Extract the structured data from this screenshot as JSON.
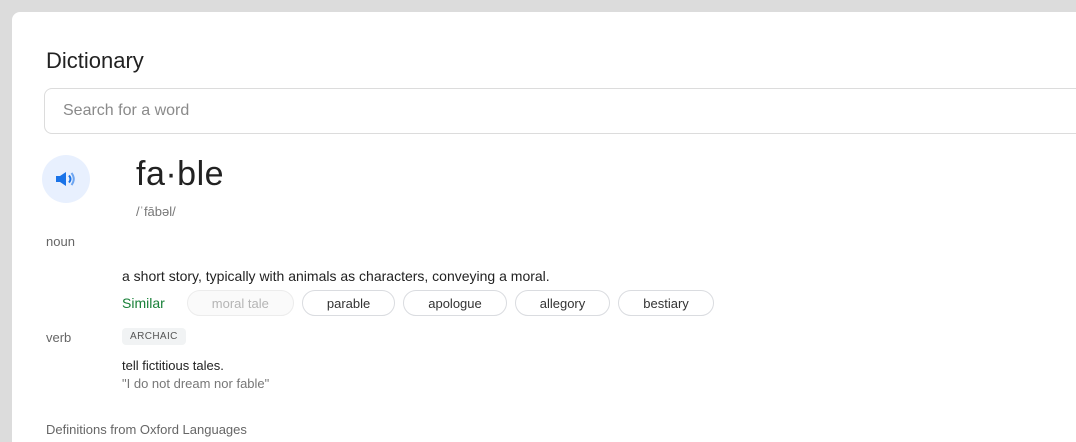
{
  "header": {
    "title": "Dictionary"
  },
  "search": {
    "placeholder": "Search for a word",
    "value": ""
  },
  "entry": {
    "word": "fa·ble",
    "phonetic": "/ˈfābəl/",
    "senses": [
      {
        "pos": "noun",
        "definition": "a short story, typically with animals as characters, conveying a moral.",
        "similar_label": "Similar",
        "similar": [
          "moral tale",
          "parable",
          "apologue",
          "allegory",
          "bestiary"
        ]
      },
      {
        "pos": "verb",
        "tag": "ARCHAIC",
        "definition": "tell fictitious tales.",
        "example": "\"I do not dream nor fable\""
      }
    ]
  },
  "footer": {
    "source": "Definitions from Oxford Languages"
  },
  "icons": {
    "speaker": "speaker-icon"
  },
  "colors": {
    "accent": "#1a73e8",
    "similar": "#188038"
  }
}
